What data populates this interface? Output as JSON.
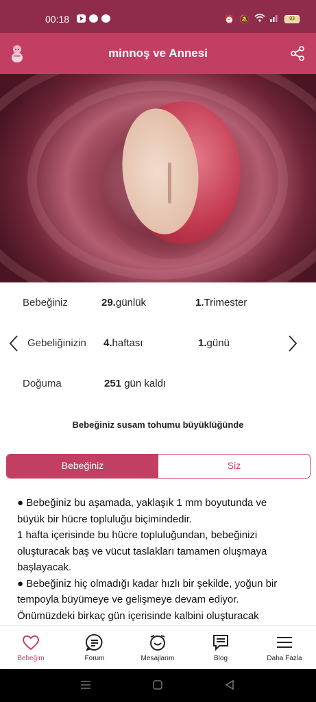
{
  "status_bar": {
    "time": "00:18",
    "battery": "93"
  },
  "header": {
    "title": "minnoş ve Annesi",
    "baby_icon": "baby-icon",
    "share_icon": "share-icon"
  },
  "info": {
    "row1": {
      "label": "Bebeğiniz",
      "value_num": "29.",
      "value_unit": "günlük",
      "extra_num": "1.",
      "extra_text": "Trimester"
    },
    "row2": {
      "label": "Gebeliğinizin",
      "value_num": "4.",
      "value_unit": "haftası",
      "extra_num": "1.",
      "extra_text": "günü"
    },
    "row3": {
      "label": "Doğuma",
      "value_num": "251",
      "value_unit": " gün kaldı"
    }
  },
  "size_note": "Bebeğiniz susam tohumu büyüklüğünde",
  "tabs": [
    {
      "label": "Bebeğiniz",
      "active": true
    },
    {
      "label": "Siz",
      "active": false
    }
  ],
  "content": {
    "p1": "● Bebeğiniz bu aşamada, yaklaşık 1 mm boyutunda ve büyük bir hücre topluluğu biçimindedir.",
    "p2": "1 hafta içerisinde bu hücre topluluğundan, bebeğinizi oluşturacak baş ve vücut taslakları tamamen oluşmaya başlayacak.",
    "p3": "● Bebeğiniz hiç olmadığı kadar hızlı bir şekilde, yoğun bir tempoyla büyümeye ve gelişmeye devam ediyor. Önümüzdeki birkaç gün içerisinde kalbini oluşturacak"
  },
  "bottom_nav": [
    {
      "label": "Bebeğim",
      "icon": "heart-icon",
      "active": true
    },
    {
      "label": "Forum",
      "icon": "forum-icon",
      "active": false
    },
    {
      "label": "Mesajlarım",
      "icon": "messages-icon",
      "active": false
    },
    {
      "label": "Blog",
      "icon": "blog-icon",
      "active": false
    },
    {
      "label": "Daha Fazla",
      "icon": "menu-icon",
      "active": false
    }
  ],
  "colors": {
    "primary": "#c23f63",
    "status_bar": "#8f2c4c"
  }
}
